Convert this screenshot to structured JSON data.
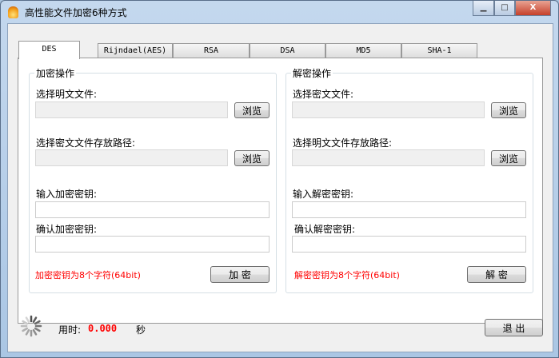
{
  "window": {
    "title": "高性能文件加密6种方式",
    "minimize": "▁",
    "maximize": "□",
    "close": "X"
  },
  "tabs": [
    {
      "label": "DES"
    },
    {
      "label": "Rijndael(AES)"
    },
    {
      "label": "RSA"
    },
    {
      "label": "DSA"
    },
    {
      "label": "MD5"
    },
    {
      "label": "SHA-1"
    }
  ],
  "encrypt": {
    "group": "加密操作",
    "source_label": "选择明文文件:",
    "source_value": "",
    "browse1": "浏览",
    "dest_label": "选择密文文件存放路径:",
    "dest_value": "",
    "browse2": "浏览",
    "key_label": "输入加密密钥:",
    "key_value": "",
    "confirm_label": "确认加密密钥:",
    "confirm_value": "",
    "hint": "加密密钥为8个字符(64bit)",
    "action": "加 密"
  },
  "decrypt": {
    "group": "解密操作",
    "source_label": "选择密文文件:",
    "source_value": "",
    "browse1": "浏览",
    "dest_label": "选择明文文件存放路径:",
    "dest_value": "",
    "browse2": "浏览",
    "key_label": "输入解密密钥:",
    "key_value": "",
    "confirm_label": "确认解密密钥:",
    "confirm_value": "",
    "hint": "解密密钥为8个字符(64bit)",
    "action": "解 密"
  },
  "footer": {
    "elapsed_label": "用时:",
    "elapsed_value": "0.000",
    "unit": "秒",
    "exit": "退 出"
  },
  "colors": {
    "hint": "#ff0000",
    "elapsed": "#ff0000"
  }
}
